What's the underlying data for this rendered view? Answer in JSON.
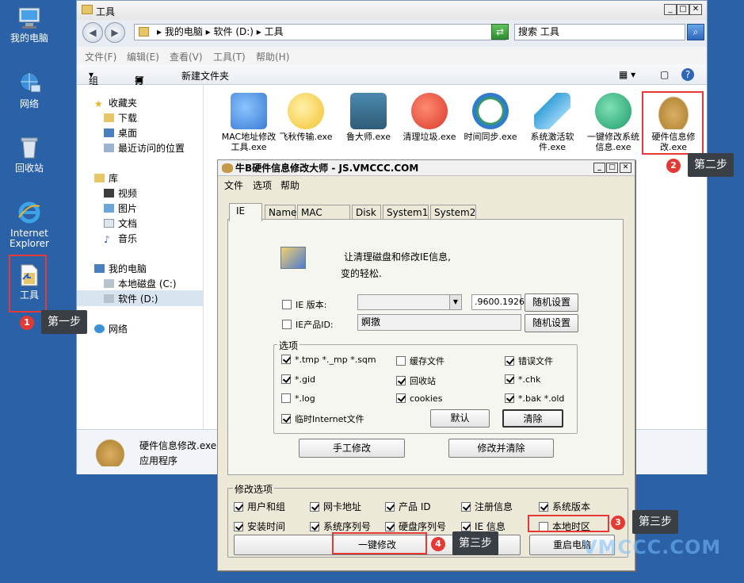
{
  "desktop": {
    "icons": [
      {
        "label": "我的电脑",
        "icon": "computer-icon"
      },
      {
        "label": "网络",
        "icon": "network-icon"
      },
      {
        "label": "回收站",
        "icon": "recycle-bin-icon"
      },
      {
        "label": "Internet Explorer",
        "icon": "internet-explorer-icon"
      },
      {
        "label": "工具",
        "icon": "folder-shortcut-icon"
      }
    ]
  },
  "explorer": {
    "title": "工具",
    "breadcrumb": [
      "我的电脑",
      "软件 (D:)",
      "工具"
    ],
    "search_placeholder": "搜索 工具",
    "menu": [
      "文件(F)",
      "编辑(E)",
      "查看(V)",
      "工具(T)",
      "帮助(H)"
    ],
    "toolbar": {
      "organize": "组织",
      "open": "打开",
      "new_folder": "新建文件夹"
    },
    "nav": [
      {
        "label": "收藏夹",
        "icon": "star-icon"
      },
      {
        "label": "下载",
        "icon": "download-folder-icon"
      },
      {
        "label": "桌面",
        "icon": "desktop-icon"
      },
      {
        "label": "最近访问的位置",
        "icon": "recent-places-icon"
      },
      {
        "label": "库",
        "icon": "library-icon"
      },
      {
        "label": "视频",
        "icon": "video-icon"
      },
      {
        "label": "图片",
        "icon": "picture-icon"
      },
      {
        "label": "文档",
        "icon": "document-icon"
      },
      {
        "label": "音乐",
        "icon": "music-icon"
      },
      {
        "label": "我的电脑",
        "icon": "computer-icon"
      },
      {
        "label": "本地磁盘 (C:)",
        "icon": "drive-icon"
      },
      {
        "label": "软件 (D:)",
        "icon": "drive-icon"
      },
      {
        "label": "网络",
        "icon": "network-icon"
      }
    ],
    "files": [
      {
        "name": "MAC地址修改工具.exe",
        "icon": "globe-network-icon",
        "color": "#3a7bd5"
      },
      {
        "name": "飞秋传输.exe",
        "icon": "chat-bubble-icon",
        "color": "#f2c230"
      },
      {
        "name": "鲁大师.exe",
        "icon": "master-lu-icon",
        "color": "#2f5c78"
      },
      {
        "name": "清理垃圾.exe",
        "icon": "cleaner-icon",
        "color": "#d83a2a"
      },
      {
        "name": "时间同步.exe",
        "icon": "clock-sync-icon",
        "color": "#3ea34a"
      },
      {
        "name": "系统激活软件.exe",
        "icon": "paper-plane-icon",
        "color": "#3aa1d9"
      },
      {
        "name": "一键修改系统信息.exe",
        "icon": "green-swirl-icon",
        "color": "#1e9c6b"
      },
      {
        "name": "硬件信息修改.exe",
        "icon": "bull-icon",
        "color": "#b98c3c"
      }
    ],
    "details": {
      "name": "硬件信息修改.exe",
      "type": "应用程序"
    }
  },
  "dialog": {
    "title": "牛B硬件信息修改大师  -  JS.VMCCC.COM",
    "menu": [
      "文件",
      "选项",
      "帮助"
    ],
    "tabs": [
      "IE",
      "Name",
      "MAC Addr",
      "Disk",
      "System1",
      "System2"
    ],
    "intro_line1": "让清理磁盘和修改IE信息,",
    "intro_line2": "变的轻松.",
    "ie_version": {
      "label": "IE 版本:",
      "value": ".9600.1926",
      "button": "随机设置"
    },
    "ie_product_id": {
      "label": "IE产品ID:",
      "value": "婀撴",
      "button": "随机设置"
    },
    "options": {
      "legend": "选项",
      "items": [
        {
          "label": "*.tmp  *._mp  *.sqm",
          "checked": true
        },
        {
          "label": "缓存文件",
          "checked": false
        },
        {
          "label": "错误文件",
          "checked": true
        },
        {
          "label": "*.gid",
          "checked": true
        },
        {
          "label": "回收站",
          "checked": true
        },
        {
          "label": "*.chk",
          "checked": true
        },
        {
          "label": "*.log",
          "checked": false
        },
        {
          "label": "cookies",
          "checked": true
        },
        {
          "label": "*.bak  *.old",
          "checked": true
        },
        {
          "label": "临时Internet文件",
          "checked": true
        }
      ],
      "default_button": "默认",
      "clear_button": "清除"
    },
    "manual_button": "手工修改",
    "modify_clear_button": "修改并清除",
    "modify_options": {
      "legend": "修改选项",
      "items": [
        {
          "label": "用户和组",
          "checked": true
        },
        {
          "label": "网卡地址",
          "checked": true
        },
        {
          "label": "产品 ID",
          "checked": true
        },
        {
          "label": "注册信息",
          "checked": true
        },
        {
          "label": "系统版本",
          "checked": true
        },
        {
          "label": "安装时间",
          "checked": true
        },
        {
          "label": "系统序列号",
          "checked": true
        },
        {
          "label": "硬盘序列号",
          "checked": true
        },
        {
          "label": "IE 信息",
          "checked": true
        },
        {
          "label": "本地时区",
          "checked": false
        }
      ]
    },
    "one_click_button": "一键修改",
    "restart_button": "重启电脑"
  },
  "annotations": {
    "step1": {
      "num": "1",
      "text": "第一步"
    },
    "step2": {
      "num": "2",
      "text": "第二步"
    },
    "step3a": {
      "num": "3",
      "text": "第三步"
    },
    "step4": {
      "num": "4",
      "text": "第三步"
    }
  },
  "watermark": "VMCCC.COM",
  "colors": {
    "desktop": "#2b61a6",
    "annotation_red": "#e53935",
    "note_bg": "#3a3f46"
  }
}
